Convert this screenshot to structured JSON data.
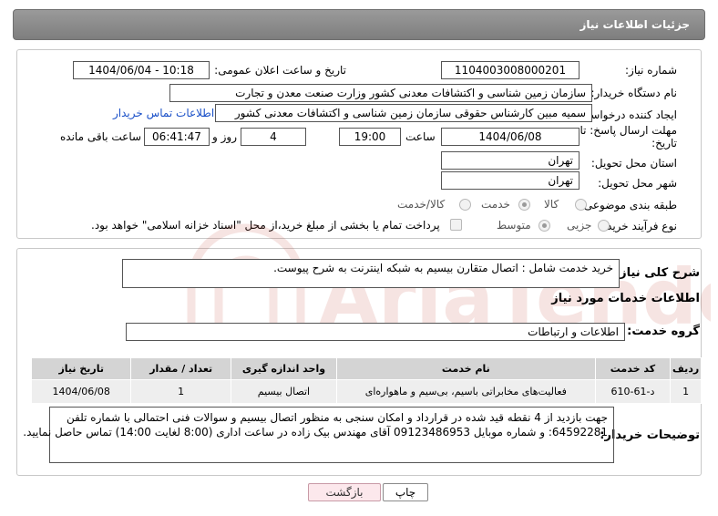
{
  "header": {
    "title": "جزئیات اطلاعات نیاز"
  },
  "fields": {
    "need_number_label": "شماره نیاز:",
    "need_number": "1104003008000201",
    "announce_label": "تاریخ و ساعت اعلان عمومی:",
    "announce_value": "1404/06/04 - 10:18",
    "buyer_label": "نام دستگاه خریدار:",
    "buyer_value": "سازمان زمین شناسی و اکتشافات معدنی کشور وزارت صنعت معدن و تجارت",
    "creator_label": "ایجاد کننده درخواست:",
    "creator_value": "سمیه مبین کارشناس حقوقی سازمان زمین شناسی و اکتشافات معدنی کشور",
    "contact_link": "اطلاعات تماس خریدار",
    "deadline_label_1": "مهلت ارسال پاسخ: تا",
    "deadline_label_2": "تاریخ:",
    "deadline_date": "1404/06/08",
    "time_label": "ساعت",
    "deadline_time": "19:00",
    "days_value": "4",
    "days_label": "روز و",
    "remaining_time": "06:41:47",
    "remaining_label": "ساعت باقی مانده",
    "province_label": "استان محل تحویل:",
    "province_value": "تهران",
    "city_label": "شهر محل تحویل:",
    "city_value": "تهران",
    "category_label": "طبقه بندی موضوعی:",
    "category_options": [
      "کالا",
      "خدمت",
      "کالا/خدمت"
    ],
    "process_label": "نوع فرآیند خرید :",
    "process_options": [
      "جزیی",
      "متوسط"
    ],
    "payment_note": "پرداخت تمام یا بخشی از مبلغ خرید،از محل \"اسناد خزانه اسلامی\" خواهد بود."
  },
  "summary": {
    "label": "شرح کلی نیاز:",
    "value": "خرید خدمت شامل : اتصال متقارن بیسیم  به شبکه اینترنت به شرح پیوست."
  },
  "services": {
    "section_title": "اطلاعات خدمات مورد نیاز",
    "group_label": "گروه خدمت:",
    "group_value": "اطلاعات و ارتباطات",
    "headers": [
      "ردیف",
      "کد خدمت",
      "نام خدمت",
      "واحد اندازه گیری",
      "تعداد / مقدار",
      "تاریخ نیاز"
    ],
    "rows": [
      [
        "1",
        "د-61-610",
        "فعالیت‌های مخابراتی باسیم، بی‌سیم و ماهواره‌ای",
        "اتصال بیسیم",
        "1",
        "1404/06/08"
      ]
    ]
  },
  "buyer_notes": {
    "label": "توضیحات خریدار:",
    "line1": "جهت بازدید از 4 نقطه قید شده در قرارداد و امکان سنجی به منظور اتصال بیسیم و سوالات فنی احتمالی با شماره تلفن",
    "line2": "64592281: و شماره موبایل 09123486953 آقای مهندس بیک زاده در ساعت اداری (8:00 لغایت 14:00) تماس حاصل نمایید."
  },
  "buttons": {
    "print": "چاپ",
    "back": "بازگشت"
  },
  "watermark": {
    "text": "AriaTender.net"
  },
  "colors": {
    "title_bar": "#8a8a8a",
    "link": "#1a50c8",
    "back_button": "#fce8ec",
    "watermark": "#c0392b"
  }
}
